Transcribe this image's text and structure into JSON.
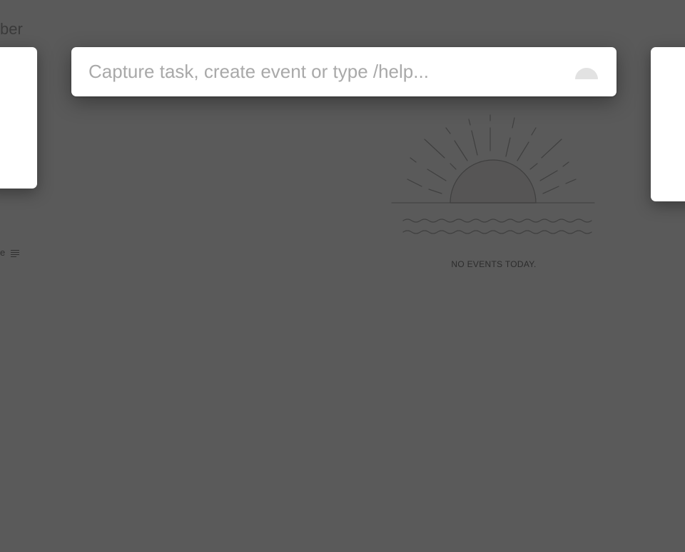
{
  "background": {
    "month_fragment": "ber",
    "clipped_label_1": "",
    "clipped_label_2": "e"
  },
  "capture": {
    "placeholder": "Capture task, create event or type /help...",
    "value": ""
  },
  "events": {
    "empty_message": "NO EVENTS TODAY."
  },
  "colors": {
    "overlay": "#5a5a5a",
    "card": "#ffffff",
    "placeholder": "#a9a9a9"
  },
  "icons": {
    "capture_indicator": "half-circle-icon",
    "empty_illustration": "sunrise-illustration-icon",
    "notes": "notes-lines-icon"
  }
}
